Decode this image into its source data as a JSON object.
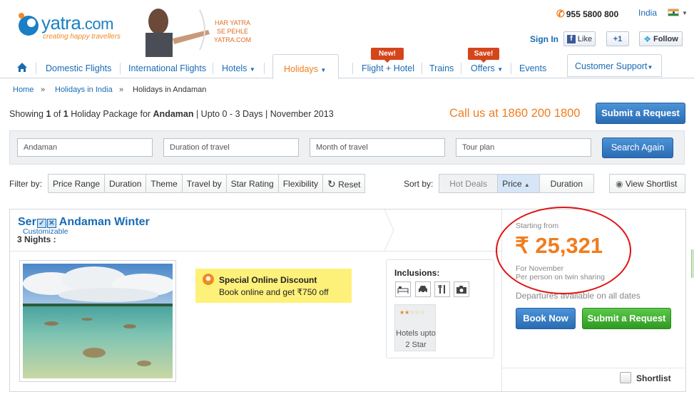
{
  "header": {
    "logo_main": "yatra",
    "logo_suffix": ".com",
    "tagline": "creating happy travellers",
    "promo_lines": [
      "HAR YATRA",
      "SE PEHLE",
      "YATRA.COM"
    ],
    "phone": "955 5800 800",
    "country": "India",
    "signin": "Sign In",
    "like": "Like",
    "plus_one": "+1",
    "follow": "Follow"
  },
  "nav": {
    "items": [
      "Domestic Flights",
      "International Flights",
      "Hotels",
      "Holidays",
      "Flight + Hotel",
      "Trains",
      "Offers",
      "Events",
      "Customer Support"
    ],
    "badge_new": "New!",
    "badge_save": "Save!"
  },
  "breadcrumb": [
    "Home",
    "Holidays in India",
    "Holidays in Andaman"
  ],
  "summary": {
    "p1": "Showing ",
    "count1": "1",
    "p2": " of ",
    "count2": "1",
    "p3": " Holiday Package for ",
    "destination": "Andaman",
    "p4": " | Upto 0 - 3 Days | November 2013"
  },
  "callus": "Call us at 1860 200 1800",
  "submit_request": "Submit a Request",
  "search": {
    "destination": "Andaman",
    "duration_placeholder": "Duration of travel",
    "month_placeholder": "Month of travel",
    "tour_placeholder": "Tour plan",
    "button": "Search Again"
  },
  "filters": {
    "label": "Filter by:",
    "items": [
      "Price Range",
      "Duration",
      "Theme",
      "Travel by",
      "Star Rating",
      "Flexibility"
    ],
    "reset": "Reset"
  },
  "sort": {
    "label": "Sort by:",
    "items": [
      "Hot Deals",
      "Price",
      "Duration"
    ],
    "active": "Price"
  },
  "view_shortlist": "View Shortlist",
  "package": {
    "title_start": "Ser",
    "title_end": "Andaman Winter",
    "customizable": "Customizable",
    "nights": "3 Nights :",
    "offer_title": "Special Online Discount",
    "offer_text": "Book online and get ₹750 off",
    "inclusions_label": "Inclusions:",
    "inclusion_icons": [
      "bed-icon",
      "car-icon",
      "dining-icon",
      "camera-icon"
    ],
    "hotel_stars": 2,
    "hotel_text": "Hotels upto",
    "hotel_star_text": "2 Star",
    "starting_from": "Starting from",
    "price": "₹ 25,321",
    "for_month": "For November",
    "per_person": "Per person on twin sharing",
    "departures": "Departures available on all dates",
    "book_now": "Book Now",
    "submit_request": "Submit a Request",
    "shortlist": "Shortlist"
  },
  "colors": {
    "brand_blue": "#1a6bb5",
    "accent_orange": "#f07d1e",
    "annotation_red": "#e01414"
  }
}
